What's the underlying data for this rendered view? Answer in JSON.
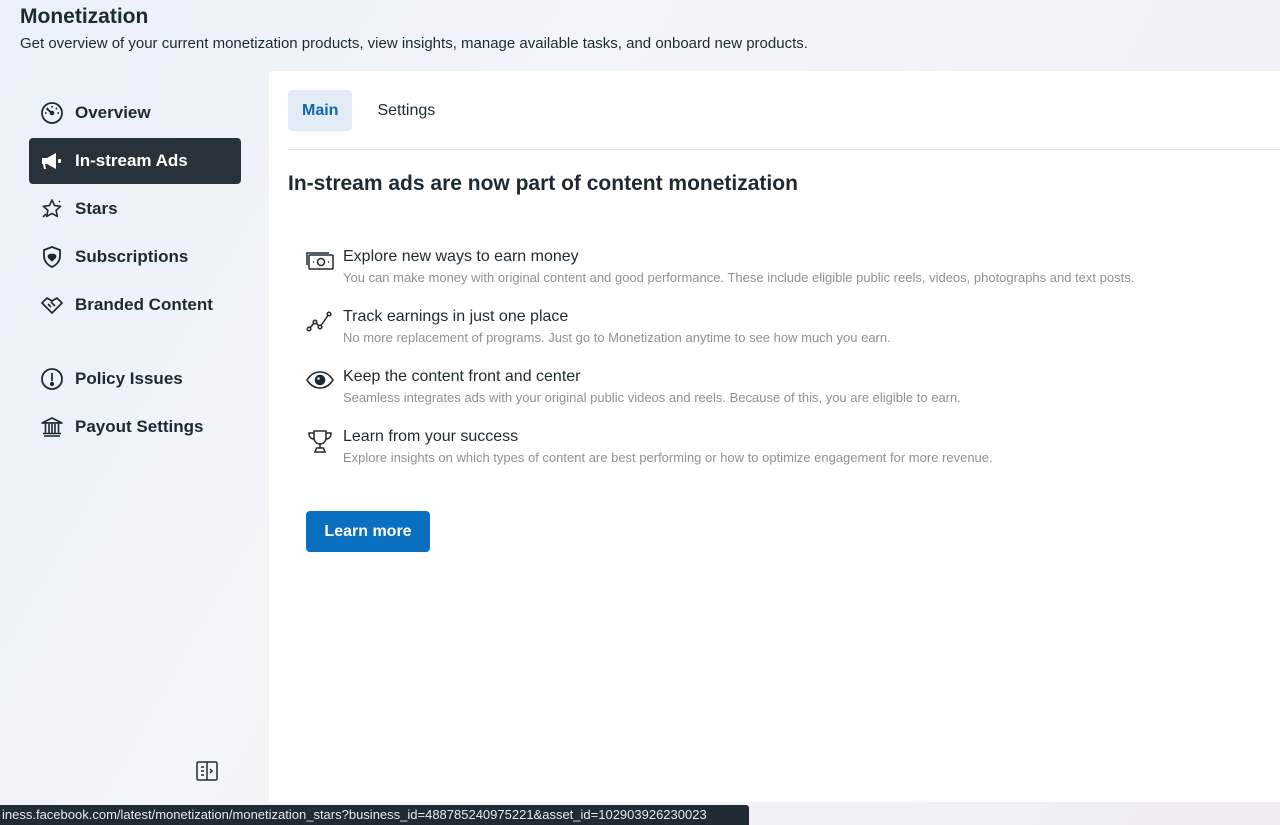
{
  "header": {
    "title": "Monetization",
    "subtitle": "Get overview of your current monetization products, view insights, manage available tasks, and onboard new products."
  },
  "sidebar": {
    "items": [
      {
        "label": "Overview",
        "icon": "dashboard-gauge-icon"
      },
      {
        "label": "In-stream Ads",
        "icon": "megaphone-icon",
        "active": true
      },
      {
        "label": "Stars",
        "icon": "stars-icon"
      },
      {
        "label": "Subscriptions",
        "icon": "shield-heart-icon"
      },
      {
        "label": "Branded Content",
        "icon": "handshake-icon"
      },
      {
        "label": "Policy Issues",
        "icon": "alert-circle-icon"
      },
      {
        "label": "Payout Settings",
        "icon": "bank-icon"
      }
    ],
    "toggle_icon": "sidebar-collapse-icon"
  },
  "tabs": [
    {
      "label": "Main",
      "active": true
    },
    {
      "label": "Settings",
      "active": false
    }
  ],
  "main": {
    "heading": "In-stream ads are now part of content monetization",
    "features": [
      {
        "icon": "money-icon",
        "title": "Explore new ways to earn money",
        "description": "You can make money with original content and good performance. These include eligible public reels, videos, photographs and text posts."
      },
      {
        "icon": "trend-line-icon",
        "title": "Track earnings in just one place",
        "description": "No more replacement of programs. Just go to Monetization anytime to see how much you earn."
      },
      {
        "icon": "eye-icon",
        "title": "Keep the content front and center",
        "description": "Seamless integrates ads with your original public videos and reels. Because of this, you are eligible to earn."
      },
      {
        "icon": "trophy-icon",
        "title": "Learn from your success",
        "description": "Explore insights on which types of content are best performing or how to optimize engagement for more revenue."
      }
    ],
    "learn_more_label": "Learn more"
  },
  "status_bar": {
    "url": "iness.facebook.com/latest/monetization/monetization_stars?business_id=488785240975221&asset_id=102903926230023"
  },
  "colors": {
    "active_nav_bg": "#27323a",
    "accent_blue": "#0b6fbf",
    "tab_active_bg": "#e2ebf6"
  }
}
